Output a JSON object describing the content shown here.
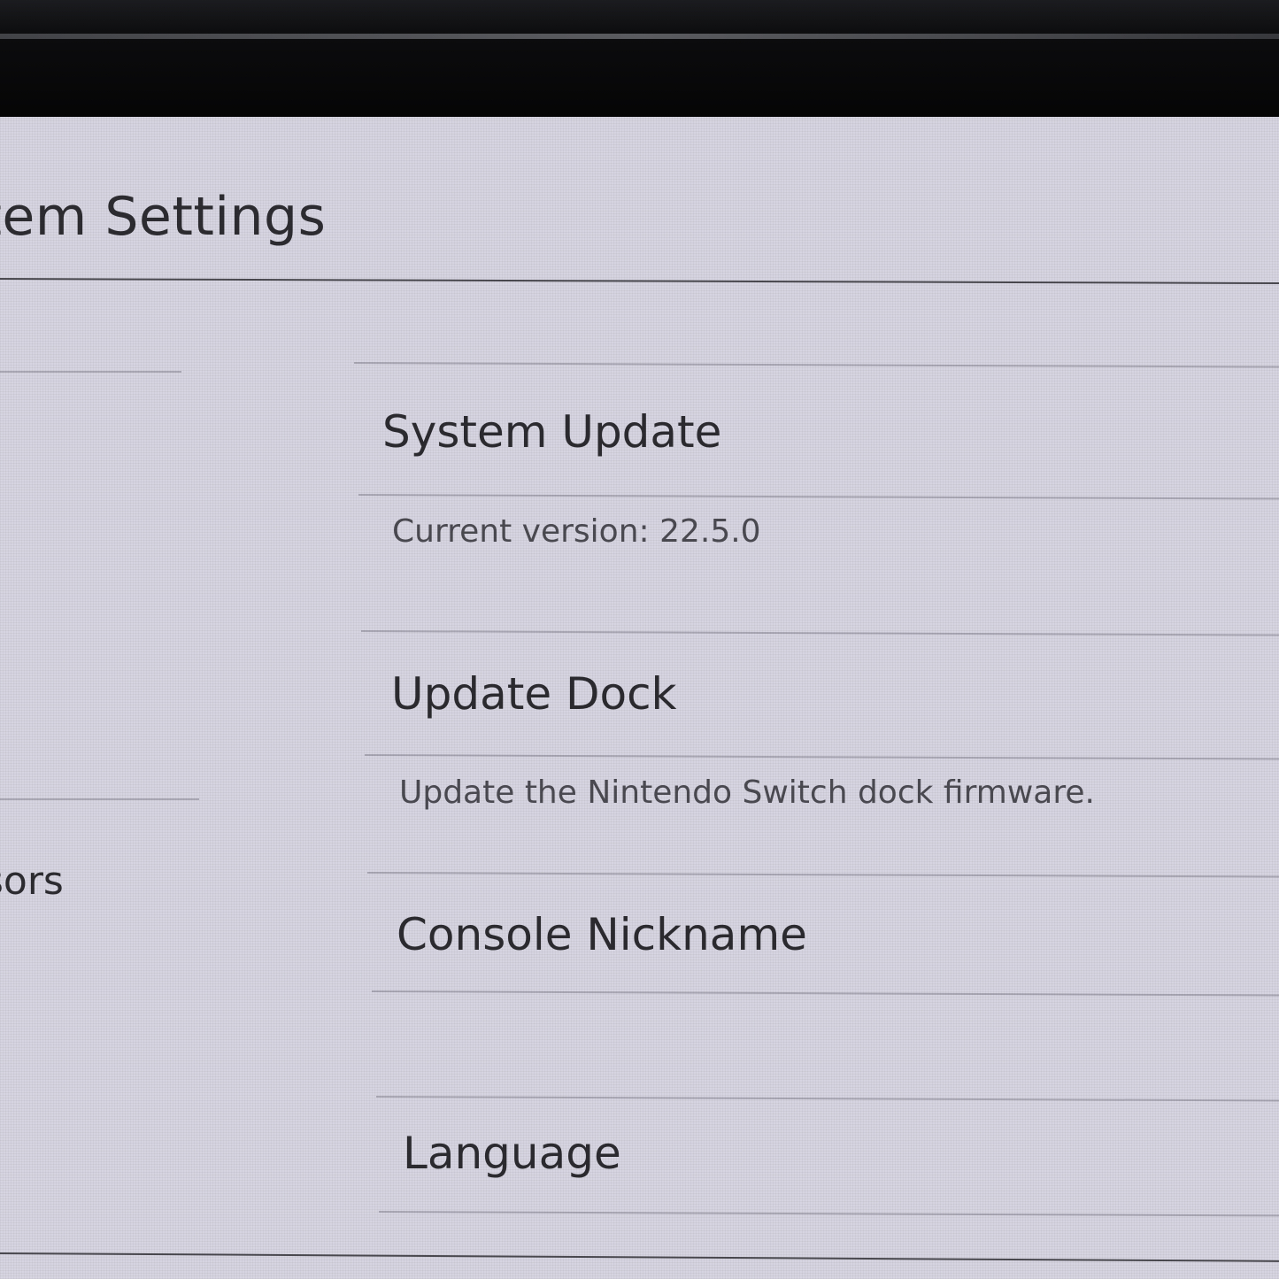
{
  "header": {
    "title": "System Settings"
  },
  "sidebar": {
    "items": [
      {
        "label": "Controllers and Sensors"
      }
    ]
  },
  "main": {
    "items": [
      {
        "title": "System Update",
        "description": "Current version: 22.5.0"
      },
      {
        "title": "Update Dock",
        "description": "Update the Nintendo Switch dock firmware."
      },
      {
        "title": "Console Nickname"
      },
      {
        "title": "Language"
      }
    ]
  }
}
